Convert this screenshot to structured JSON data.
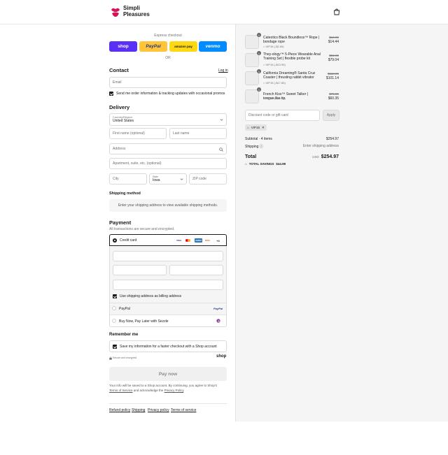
{
  "brand": {
    "line1": "Simpli",
    "line2": "Pleasures"
  },
  "header": {
    "bag_icon": "shopping-bag-icon"
  },
  "express": {
    "label": "Express checkout",
    "buttons": [
      {
        "label": "shop",
        "bg": "#5a31f4",
        "fg": "#ffffff"
      },
      {
        "label": "PayPal",
        "bg": "#ffc439",
        "fg": "#253b80"
      },
      {
        "label": "amazon pay",
        "bg": "#ffd814",
        "fg": "#111111"
      },
      {
        "label": "venmo",
        "bg": "#008cff",
        "fg": "#ffffff"
      }
    ],
    "or": "OR"
  },
  "contact": {
    "title": "Contact",
    "login": "Log in",
    "email_placeholder": "Email",
    "news_label": "Send me order information & tracking updates with occasional promos"
  },
  "delivery": {
    "title": "Delivery",
    "country_label": "Country/Region",
    "country_value": "United States",
    "first_name": "First name (optional)",
    "last_name": "Last name",
    "address": "Address",
    "apartment": "Apartment, suite, etc. (optional)",
    "city": "City",
    "state_label": "State",
    "state_value": "Iowa",
    "zip": "ZIP code"
  },
  "shipping": {
    "title": "Shipping method",
    "note": "Enter your shipping address to view available shipping methods."
  },
  "payment": {
    "title": "Payment",
    "subtitle": "All transactions are secure and encrypted.",
    "credit_card": "Credit card",
    "cards": [
      "VISA",
      "MC",
      "AMEX",
      "DISC",
      "+4"
    ],
    "billing_label": "Use shipping address as billing address",
    "paypal": "PayPal",
    "paypal_logo": "PayPal",
    "sezzle": "Buy Now, Pay Later with Sezzle"
  },
  "remember": {
    "title": "Remember me",
    "save_label": "Save my information for a faster checkout with a Shop account",
    "secure": "Secure and encrypted",
    "shop": "shop"
  },
  "pay_now": "Pay now",
  "legal": {
    "text1": "Your info will be saved to a Shop account. By continuing, you agree to Shop's",
    "tos": "Terms of Service",
    "and": " and acknowledge the ",
    "privacy": "Privacy Policy",
    "end": "."
  },
  "footer_links": [
    "Refund policy",
    "Shipping",
    "Privacy policy",
    "Terms of service"
  ],
  "summary": {
    "items": [
      {
        "qty": "1",
        "name": "Cateotics Black Boundless™ Rope | bondage rope",
        "discount": "VIP15 (-$2.55)",
        "was": "$16.99",
        "price": "$14.44"
      },
      {
        "qty": "1",
        "name": "They-ology™ 5-Piece Wearable Anal Training Set | flexible probe kit",
        "discount": "VIP15 (-$13.95)",
        "was": "$92.99",
        "price": "$79.04"
      },
      {
        "qty": "1",
        "name": "California Dreaming® Santa Cruz Coaster | thrusting rabbit vibrator",
        "discount": "VIP15 (-$17.85)",
        "was": "$118.99",
        "price": "$101.14"
      },
      {
        "qty": "1",
        "name": "French Kiss™ Sweet Talker | tongue-like tip",
        "discount": "VIP15 (-$10.64)",
        "was": "$70.99",
        "price": "$60.35"
      }
    ],
    "discount_placeholder": "Discount code or gift card",
    "apply": "Apply",
    "code_tag": "VIP15",
    "subtotal_label": "Subtotal · 4 items",
    "subtotal_value": "$254.97",
    "shipping_label": "Shipping",
    "shipping_value": "Enter shipping address",
    "total_label": "Total",
    "currency": "USD",
    "total_value": "$254.97",
    "savings_label": "TOTAL SAVINGS",
    "savings_value": "$44.99"
  }
}
